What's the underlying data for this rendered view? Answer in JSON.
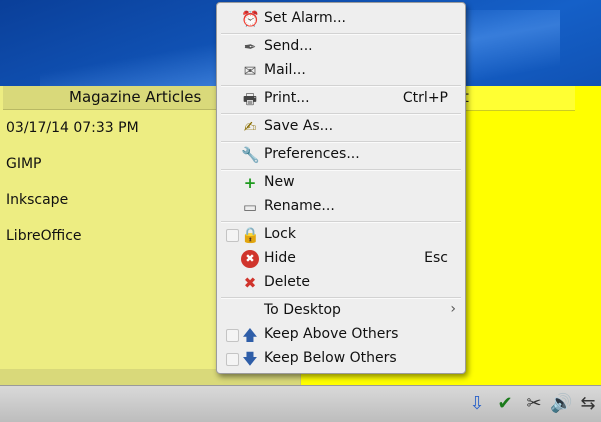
{
  "colors": {
    "desktop": "#1560c8",
    "note_left_bg": "#eded82",
    "note_right_bg": "#ffff00",
    "menu_bg": "#eeeeee",
    "taskbar_bg": "#cfcfcf"
  },
  "note_left": {
    "title": "Magazine Articles",
    "lines": [
      "03/17/14 07:33 PM",
      "GIMP",
      "Inkscape",
      "LibreOffice"
    ]
  },
  "note_right": {
    "title_fragment": "t"
  },
  "menu": {
    "items": [
      {
        "label": "Set Alarm...",
        "icon": "alarm-clock-icon",
        "glyph": "⏰",
        "shortcut": ""
      },
      {
        "label": "Send...",
        "icon": "pen-icon",
        "glyph": "✒",
        "shortcut": ""
      },
      {
        "label": "Mail...",
        "icon": "envelope-icon",
        "glyph": "✉",
        "shortcut": ""
      },
      {
        "label": "Print...",
        "icon": "printer-icon",
        "glyph": "🖶",
        "shortcut": "Ctrl+P"
      },
      {
        "label": "Save As...",
        "icon": "save-as-icon",
        "glyph": "✍",
        "shortcut": ""
      },
      {
        "label": "Preferences...",
        "icon": "wrench-icon",
        "glyph": "🔧",
        "shortcut": ""
      },
      {
        "label": "New",
        "icon": "new-note-icon",
        "glyph": "+",
        "shortcut": ""
      },
      {
        "label": "Rename...",
        "icon": "rename-icon",
        "glyph": "▭",
        "shortcut": ""
      },
      {
        "label": "Lock",
        "icon": "padlock-icon",
        "glyph": "🔒",
        "shortcut": ""
      },
      {
        "label": "Hide",
        "icon": "hide-icon",
        "glyph": "✖",
        "shortcut": "Esc"
      },
      {
        "label": "Delete",
        "icon": "delete-x-icon",
        "glyph": "✖",
        "shortcut": ""
      },
      {
        "label": "To Desktop",
        "icon": "",
        "glyph": "",
        "shortcut": "",
        "submenu_glyph": "›"
      },
      {
        "label": "Keep Above Others",
        "icon": "arrow-up-icon",
        "glyph": "🡅",
        "shortcut": ""
      },
      {
        "label": "Keep Below Others",
        "icon": "arrow-down-icon",
        "glyph": "🡇",
        "shortcut": ""
      }
    ]
  },
  "tray": [
    {
      "icon": "update-notifier-icon",
      "glyph": "⇩"
    },
    {
      "icon": "checkmark-icon",
      "glyph": "✔"
    },
    {
      "icon": "scissors-icon",
      "glyph": "✂"
    },
    {
      "icon": "volume-icon",
      "glyph": "🔊"
    },
    {
      "icon": "network-icon",
      "glyph": "⇆"
    }
  ]
}
